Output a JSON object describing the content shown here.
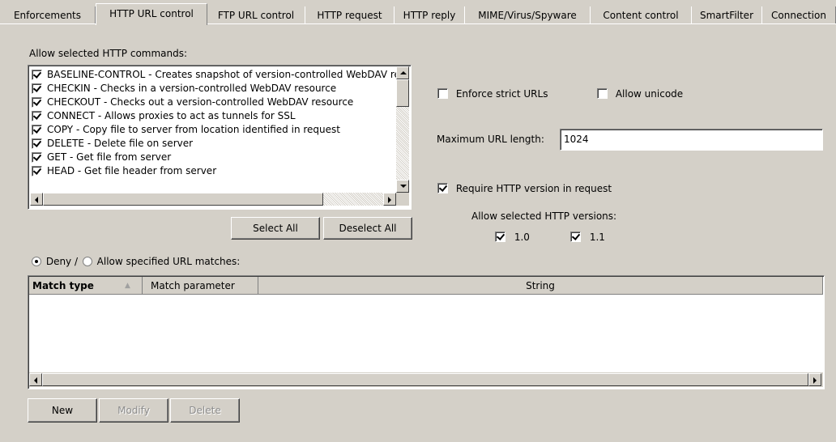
{
  "tabs": [
    {
      "label": "Enforcements"
    },
    {
      "label": "HTTP URL control",
      "active": true
    },
    {
      "label": "FTP URL control"
    },
    {
      "label": "HTTP request"
    },
    {
      "label": "HTTP reply"
    },
    {
      "label": "MIME/Virus/Spyware"
    },
    {
      "label": "Content control"
    },
    {
      "label": "SmartFilter"
    },
    {
      "label": "Connection"
    }
  ],
  "commands": {
    "label": "Allow selected HTTP commands:",
    "items": [
      {
        "text": "BASELINE-CONTROL - Creates snapshot of version-controlled WebDAV resource",
        "checked": true
      },
      {
        "text": "CHECKIN - Checks in a version-controlled WebDAV resource",
        "checked": true
      },
      {
        "text": "CHECKOUT - Checks out a version-controlled WebDAV resource",
        "checked": true
      },
      {
        "text": "CONNECT - Allows proxies to act as tunnels for SSL",
        "checked": true
      },
      {
        "text": "COPY - Copy file to server from location identified in request",
        "checked": true
      },
      {
        "text": "DELETE - Delete file on server",
        "checked": true
      },
      {
        "text": "GET - Get file from server",
        "checked": true
      },
      {
        "text": "HEAD - Get file header from server",
        "checked": true
      }
    ],
    "select_all": "Select All",
    "deselect_all": "Deselect All"
  },
  "options": {
    "enforce_strict_urls": {
      "label": "Enforce strict URLs",
      "checked": false
    },
    "allow_unicode": {
      "label": "Allow unicode",
      "checked": false
    },
    "max_url_length_label": "Maximum URL length:",
    "max_url_length_value": "1024",
    "require_http_version": {
      "label": "Require HTTP version in request",
      "checked": true
    },
    "versions_label": "Allow selected HTTP versions:",
    "versions": [
      {
        "label": "1.0",
        "checked": true
      },
      {
        "label": "1.1",
        "checked": true
      }
    ]
  },
  "url_matches": {
    "deny_label": "Deny /",
    "allow_label": "Allow specified URL matches:",
    "mode": "deny",
    "columns": [
      "Match type",
      "Match parameter",
      "String"
    ],
    "rows": []
  },
  "actions": {
    "new": "New",
    "modify": "Modify",
    "delete": "Delete"
  }
}
